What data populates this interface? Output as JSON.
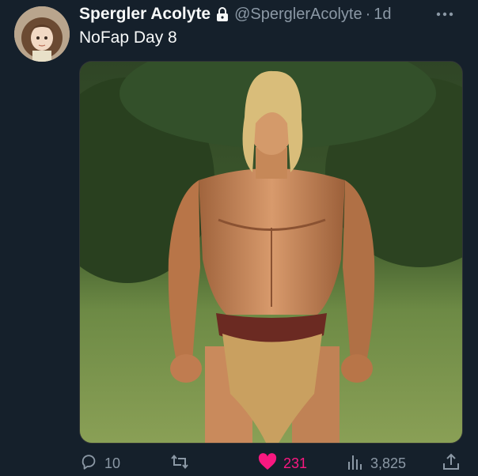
{
  "tweet": {
    "author": {
      "display_name": "Spergler Acolyte",
      "handle": "@SperglerAcolyte",
      "protected": true
    },
    "separator": "·",
    "time": "1d",
    "text": "NoFap Day 8",
    "media": {
      "kind": "photo"
    },
    "actions": {
      "reply": {
        "icon": "reply-icon",
        "count": "10"
      },
      "retweet": {
        "icon": "retweet-icon",
        "count": ""
      },
      "like": {
        "icon": "heart-icon",
        "count": "231",
        "liked": true,
        "color": "#f91880"
      },
      "views": {
        "icon": "views-icon",
        "count": "3,825"
      },
      "share": {
        "icon": "share-icon"
      }
    }
  },
  "colors": {
    "background": "#15202b",
    "primary_text": "#f7f9f9",
    "secondary_text": "#8b98a5",
    "like_active": "#f91880"
  }
}
